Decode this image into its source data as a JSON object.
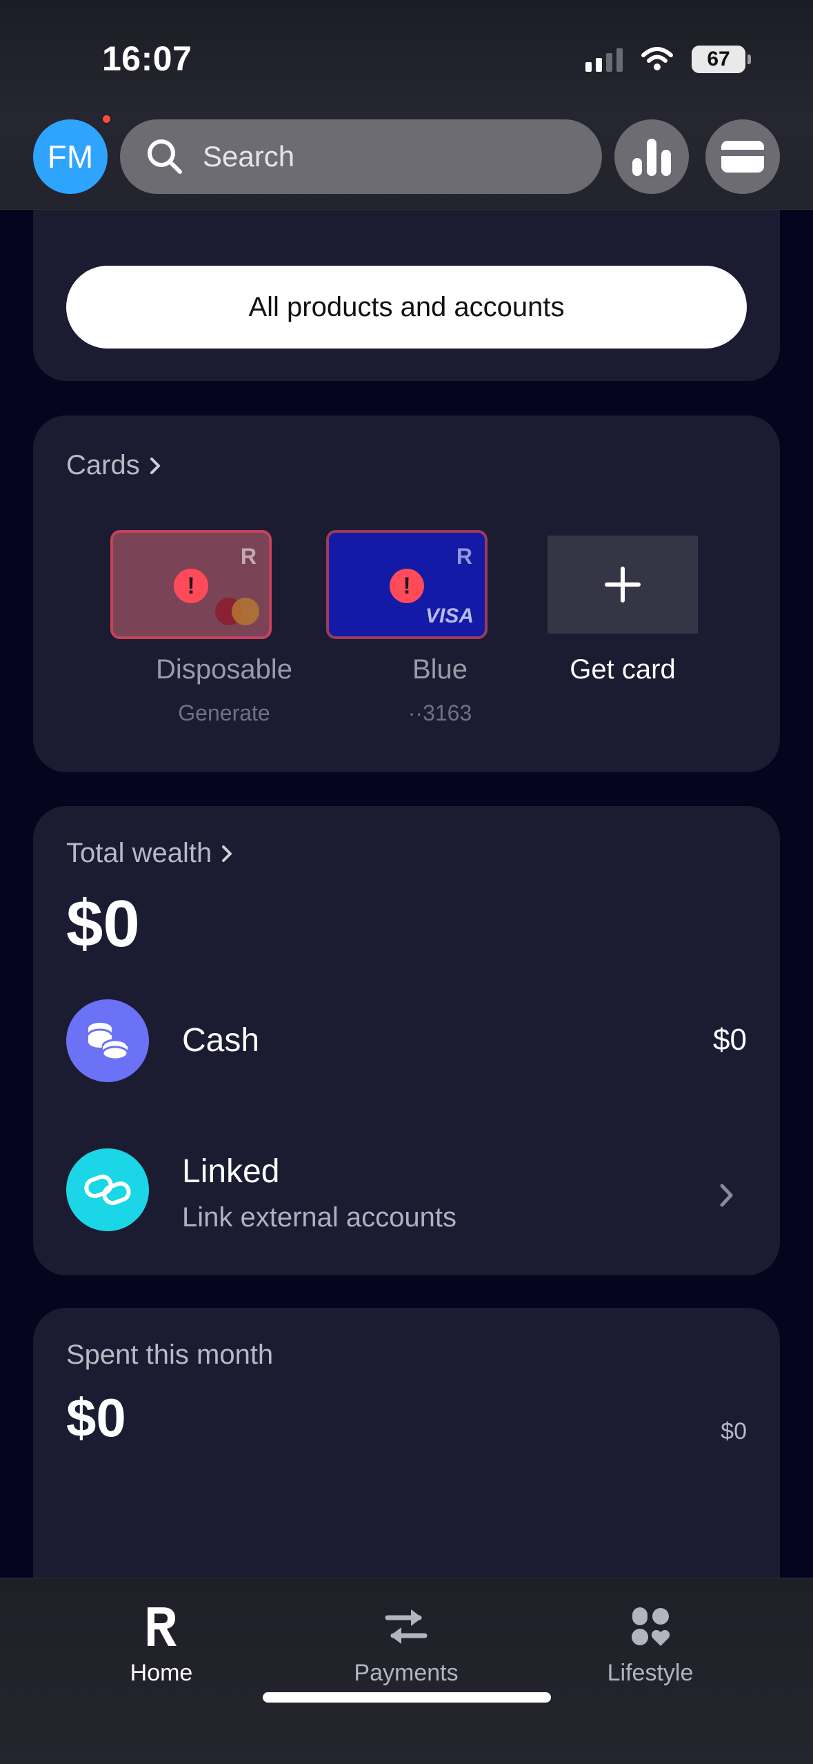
{
  "status_bar": {
    "time": "16:07",
    "battery": "67"
  },
  "header": {
    "avatar_initials": "FM",
    "search_placeholder": "Search"
  },
  "top_card": {
    "button_label": "All products and accounts"
  },
  "cards_section": {
    "title": "Cards",
    "cards": [
      {
        "name": "Disposable",
        "sub": "Generate"
      },
      {
        "name": "Blue",
        "sub": "··3163"
      },
      {
        "name": "Get card",
        "sub": ""
      }
    ],
    "logo_letter": "R",
    "network_label": "VISA"
  },
  "wealth": {
    "title": "Total wealth",
    "amount": "$0",
    "rows": [
      {
        "title": "Cash",
        "value": "$0"
      },
      {
        "title": "Linked",
        "sub": "Link external accounts"
      }
    ]
  },
  "spent": {
    "title": "Spent this month",
    "amount": "$0",
    "right_value": "$0"
  },
  "bottom_nav": {
    "items": [
      {
        "label": "Home"
      },
      {
        "label": "Payments"
      },
      {
        "label": "Lifestyle"
      }
    ]
  },
  "colors": {
    "avatar": "#2ea4ff",
    "cash_icon_bg": "#6b72f5",
    "linked_icon_bg": "#1ad6e6",
    "card_bg": "#1b1b31",
    "alert": "#ff4a5a"
  }
}
